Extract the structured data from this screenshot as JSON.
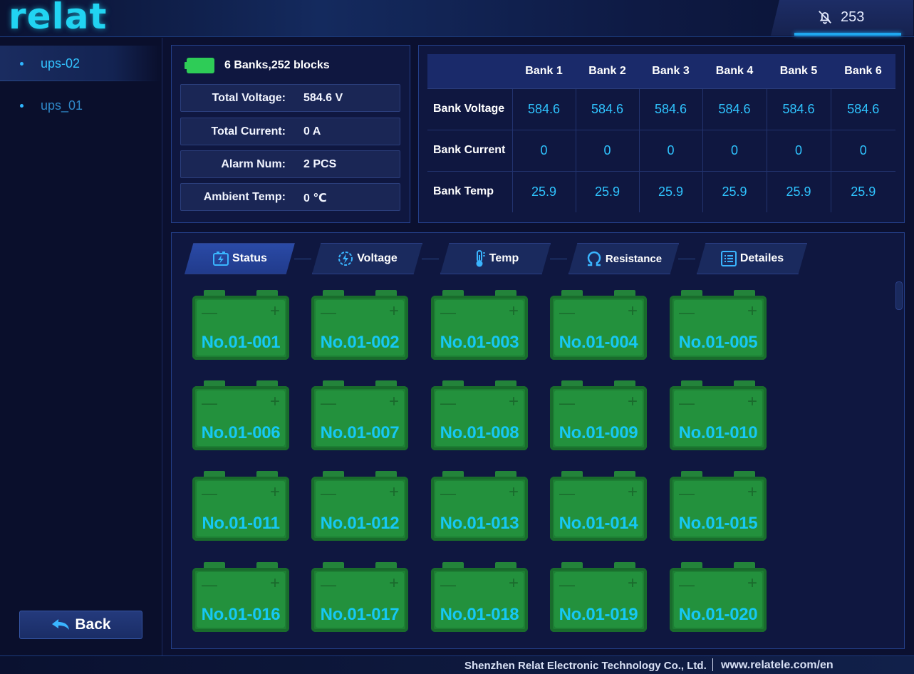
{
  "header": {
    "logo_text": "relat",
    "alarm_count": "253",
    "alarm_icon": "bell-off-icon"
  },
  "sidebar": {
    "items": [
      {
        "label": "ups-02",
        "active": true
      },
      {
        "label": "ups_01",
        "active": false
      }
    ],
    "back_label": "Back"
  },
  "summary": {
    "title": "6 Banks,252 blocks",
    "rows": [
      {
        "label": "Total Voltage:",
        "value": "584.6  V"
      },
      {
        "label": "Total Current:",
        "value": "0   A"
      },
      {
        "label": "Alarm Num:",
        "value": "2  PCS"
      },
      {
        "label": "Ambient Temp:",
        "value": "0  ℃"
      }
    ]
  },
  "bank_table": {
    "headers": [
      "Bank 1",
      "Bank 2",
      "Bank 3",
      "Bank 4",
      "Bank 5",
      "Bank 6"
    ],
    "rows": [
      {
        "label": "Bank Voltage",
        "values": [
          "584.6",
          "584.6",
          "584.6",
          "584.6",
          "584.6",
          "584.6"
        ]
      },
      {
        "label": "Bank Current",
        "values": [
          "0",
          "0",
          "0",
          "0",
          "0",
          "0"
        ]
      },
      {
        "label": "Bank Temp",
        "values": [
          "25.9",
          "25.9",
          "25.9",
          "25.9",
          "25.9",
          "25.9"
        ]
      }
    ]
  },
  "tabs": [
    {
      "label": "Status",
      "icon": "battery-charge-icon",
      "active": true
    },
    {
      "label": "Voltage",
      "icon": "gauge-icon",
      "active": false
    },
    {
      "label": "Temp",
      "icon": "thermometer-icon",
      "active": false
    },
    {
      "label": "Resistance",
      "icon": "ohm-icon",
      "active": false
    },
    {
      "label": "Detailes",
      "icon": "list-icon",
      "active": false
    }
  ],
  "batteries": [
    "No.01-001",
    "No.01-002",
    "No.01-003",
    "No.01-004",
    "No.01-005",
    "No.01-006",
    "No.01-007",
    "No.01-008",
    "No.01-009",
    "No.01-010",
    "No.01-011",
    "No.01-012",
    "No.01-013",
    "No.01-014",
    "No.01-015",
    "No.01-016",
    "No.01-017",
    "No.01-018",
    "No.01-019",
    "No.01-020"
  ],
  "battery_symbols": {
    "minus": "—",
    "plus": "+"
  },
  "footer": {
    "company": "Shenzhen Relat Electronic Technology Co., Ltd.",
    "url": "www.relatele.com/en"
  },
  "colors": {
    "accent": "#2fc4ff",
    "battery_ok": "#23913d",
    "panel_bg": "#0f1740"
  }
}
